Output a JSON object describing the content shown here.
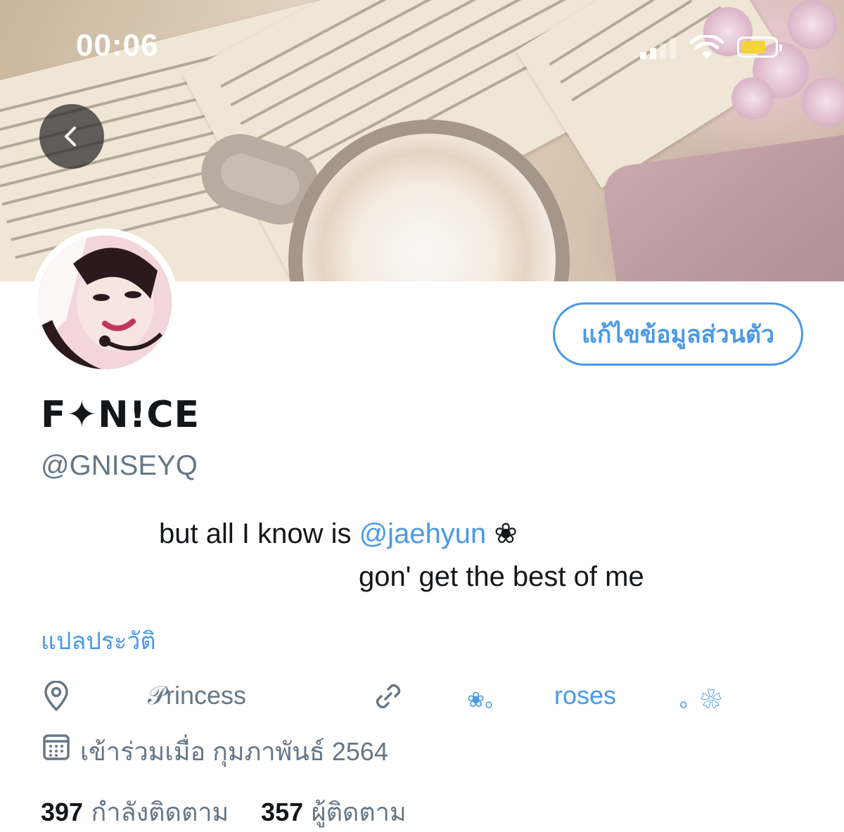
{
  "status_bar": {
    "time": "00:06"
  },
  "profile": {
    "display_name": "F✦N!CE",
    "handle": "@GNISEYQ",
    "edit_profile_label": "แก้ไขข้อมูลส่วนตัว",
    "bio_line1_prefix": "but all I know is ",
    "bio_mention": "@jaehyun",
    "bio_line1_suffix": " ❀",
    "bio_line2": "gon' get the best of me",
    "translate_bio_label": "แปลประวัติ",
    "location": "𝒫rincess",
    "link_prefix": "❀。",
    "link_text": "roses",
    "link_suffix": "。❀",
    "joined": "เข้าร่วมเมื่อ กุมภาพันธ์ 2564",
    "following_count": "397",
    "following_label": "กำลังติดตาม",
    "followers_count": "357",
    "followers_label": "ผู้ติดตาม"
  },
  "icons": {
    "back": "chevron-left-icon",
    "location": "location-pin-icon",
    "link": "link-icon",
    "calendar": "calendar-icon"
  },
  "colors": {
    "accent": "#4a99e9",
    "text_primary": "#14171a",
    "text_secondary": "#657786",
    "battery": "#f5d33b"
  }
}
